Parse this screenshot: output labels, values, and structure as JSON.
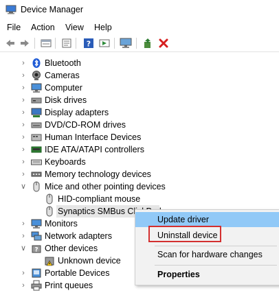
{
  "window": {
    "title": "Device Manager"
  },
  "menu": [
    "File",
    "Action",
    "View",
    "Help"
  ],
  "toolbar": {
    "icons": [
      "back-arrow-icon",
      "forward-arrow-icon",
      "show-hidden-icon",
      "properties-sheet-icon",
      "help-icon",
      "run-icon",
      "monitor-icon",
      "add-driver-icon",
      "uninstall-x-icon"
    ]
  },
  "tree": {
    "items": [
      {
        "label": "Bluetooth",
        "icon": "bluetooth-icon",
        "expanded": false
      },
      {
        "label": "Cameras",
        "icon": "camera-icon",
        "expanded": false
      },
      {
        "label": "Computer",
        "icon": "computer-icon",
        "expanded": false
      },
      {
        "label": "Disk drives",
        "icon": "disk-drive-icon",
        "expanded": false
      },
      {
        "label": "Display adapters",
        "icon": "display-adapter-icon",
        "expanded": false
      },
      {
        "label": "DVD/CD-ROM drives",
        "icon": "dvd-drive-icon",
        "expanded": false
      },
      {
        "label": "Human Interface Devices",
        "icon": "hid-icon",
        "expanded": false
      },
      {
        "label": "IDE ATA/ATAPI controllers",
        "icon": "ide-controller-icon",
        "expanded": false
      },
      {
        "label": "Keyboards",
        "icon": "keyboard-icon",
        "expanded": false
      },
      {
        "label": "Memory technology devices",
        "icon": "memory-icon",
        "expanded": false
      },
      {
        "label": "Mice and other pointing devices",
        "icon": "mouse-icon",
        "expanded": true
      },
      {
        "label": "HID-compliant mouse",
        "icon": "mouse-icon",
        "child": true
      },
      {
        "label": "Synaptics SMBus ClickPad",
        "icon": "mouse-icon",
        "child": true,
        "selected": true
      },
      {
        "label": "Monitors",
        "icon": "monitor-icon",
        "expanded": false
      },
      {
        "label": "Network adapters",
        "icon": "network-adapter-icon",
        "expanded": false
      },
      {
        "label": "Other devices",
        "icon": "other-devices-icon",
        "expanded": true
      },
      {
        "label": "Unknown device",
        "icon": "warning-icon",
        "child": true
      },
      {
        "label": "Portable Devices",
        "icon": "portable-device-icon",
        "expanded": false
      },
      {
        "label": "Print queues",
        "icon": "printer-icon",
        "expanded": false
      }
    ]
  },
  "context_menu": {
    "update": "Update driver",
    "uninstall": "Uninstall device",
    "scan": "Scan for hardware changes",
    "properties": "Properties"
  },
  "colors": {
    "highlight": "#91c9f7",
    "annotation_box": "#d32f2f",
    "selection": "#e6e6e6"
  }
}
